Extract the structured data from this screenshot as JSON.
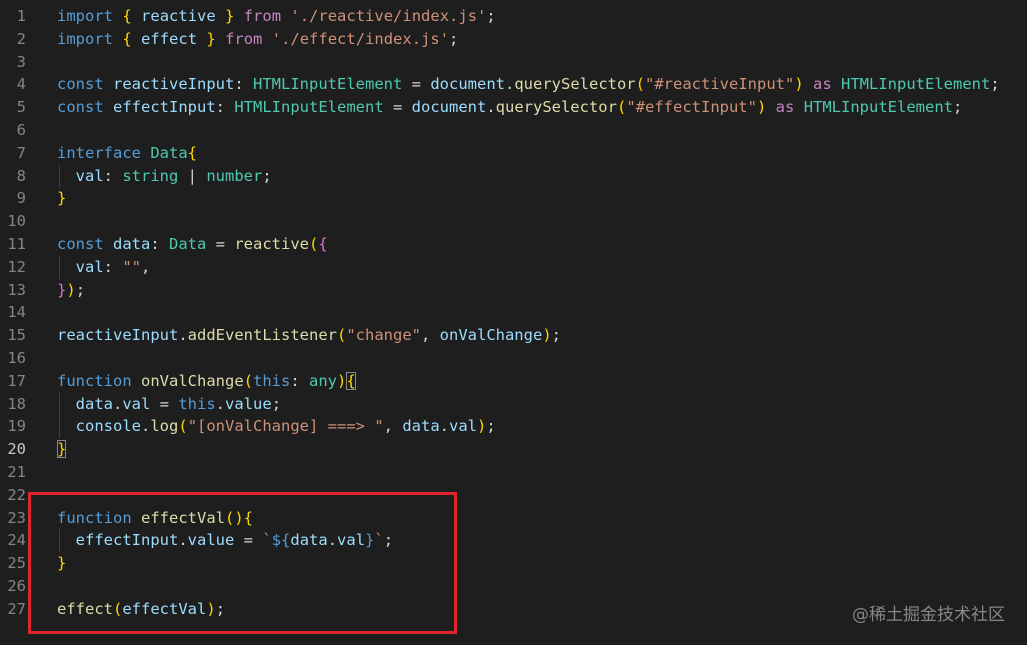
{
  "editor": {
    "active_line": 20,
    "lines": [
      {
        "n": "1",
        "indent": 0,
        "tokens": [
          [
            "kw",
            "import"
          ],
          [
            "pun",
            " "
          ],
          [
            "br1",
            "{"
          ],
          [
            "pun",
            " "
          ],
          [
            "var",
            "reactive"
          ],
          [
            "pun",
            " "
          ],
          [
            "br1",
            "}"
          ],
          [
            "pun",
            " "
          ],
          [
            "ctl",
            "from"
          ],
          [
            "pun",
            " "
          ],
          [
            "str",
            "'./reactive/index.js'"
          ],
          [
            "pun",
            ";"
          ]
        ]
      },
      {
        "n": "2",
        "indent": 0,
        "tokens": [
          [
            "kw",
            "import"
          ],
          [
            "pun",
            " "
          ],
          [
            "br1",
            "{"
          ],
          [
            "pun",
            " "
          ],
          [
            "var",
            "effect"
          ],
          [
            "pun",
            " "
          ],
          [
            "br1",
            "}"
          ],
          [
            "pun",
            " "
          ],
          [
            "ctl",
            "from"
          ],
          [
            "pun",
            " "
          ],
          [
            "str",
            "'./effect/index.js'"
          ],
          [
            "pun",
            ";"
          ]
        ]
      },
      {
        "n": "3",
        "indent": 0,
        "tokens": []
      },
      {
        "n": "4",
        "indent": 0,
        "tokens": [
          [
            "kw",
            "const"
          ],
          [
            "pun",
            " "
          ],
          [
            "var",
            "reactiveInput"
          ],
          [
            "pun",
            ": "
          ],
          [
            "typ",
            "HTMLInputElement"
          ],
          [
            "pun",
            " = "
          ],
          [
            "var",
            "document"
          ],
          [
            "pun",
            "."
          ],
          [
            "fn",
            "querySelector"
          ],
          [
            "br1",
            "("
          ],
          [
            "str",
            "\"#reactiveInput\""
          ],
          [
            "br1",
            ")"
          ],
          [
            "pun",
            " "
          ],
          [
            "ctl",
            "as"
          ],
          [
            "pun",
            " "
          ],
          [
            "typ",
            "HTMLInputElement"
          ],
          [
            "pun",
            ";"
          ]
        ]
      },
      {
        "n": "5",
        "indent": 0,
        "tokens": [
          [
            "kw",
            "const"
          ],
          [
            "pun",
            " "
          ],
          [
            "var",
            "effectInput"
          ],
          [
            "pun",
            ": "
          ],
          [
            "typ",
            "HTMLInputElement"
          ],
          [
            "pun",
            " = "
          ],
          [
            "var",
            "document"
          ],
          [
            "pun",
            "."
          ],
          [
            "fn",
            "querySelector"
          ],
          [
            "br1",
            "("
          ],
          [
            "str",
            "\"#effectInput\""
          ],
          [
            "br1",
            ")"
          ],
          [
            "pun",
            " "
          ],
          [
            "ctl",
            "as"
          ],
          [
            "pun",
            " "
          ],
          [
            "typ",
            "HTMLInputElement"
          ],
          [
            "pun",
            ";"
          ]
        ]
      },
      {
        "n": "6",
        "indent": 0,
        "tokens": []
      },
      {
        "n": "7",
        "indent": 0,
        "tokens": [
          [
            "kw",
            "interface"
          ],
          [
            "pun",
            " "
          ],
          [
            "typ",
            "Data"
          ],
          [
            "br1",
            "{"
          ]
        ]
      },
      {
        "n": "8",
        "indent": 1,
        "tokens": [
          [
            "var",
            "val"
          ],
          [
            "pun",
            ": "
          ],
          [
            "typ",
            "string"
          ],
          [
            "pun",
            " | "
          ],
          [
            "typ",
            "number"
          ],
          [
            "pun",
            ";"
          ]
        ]
      },
      {
        "n": "9",
        "indent": 0,
        "tokens": [
          [
            "br1",
            "}"
          ]
        ]
      },
      {
        "n": "10",
        "indent": 0,
        "tokens": []
      },
      {
        "n": "11",
        "indent": 0,
        "tokens": [
          [
            "kw",
            "const"
          ],
          [
            "pun",
            " "
          ],
          [
            "var",
            "data"
          ],
          [
            "pun",
            ": "
          ],
          [
            "typ",
            "Data"
          ],
          [
            "pun",
            " = "
          ],
          [
            "fn",
            "reactive"
          ],
          [
            "br1",
            "("
          ],
          [
            "br2",
            "{"
          ]
        ]
      },
      {
        "n": "12",
        "indent": 1,
        "tokens": [
          [
            "var",
            "val"
          ],
          [
            "pun",
            ": "
          ],
          [
            "str",
            "\"\""
          ],
          [
            "pun",
            ","
          ]
        ]
      },
      {
        "n": "13",
        "indent": 0,
        "tokens": [
          [
            "br2",
            "}"
          ],
          [
            "br1",
            ")"
          ],
          [
            "pun",
            ";"
          ]
        ]
      },
      {
        "n": "14",
        "indent": 0,
        "tokens": []
      },
      {
        "n": "15",
        "indent": 0,
        "tokens": [
          [
            "var",
            "reactiveInput"
          ],
          [
            "pun",
            "."
          ],
          [
            "fn",
            "addEventListener"
          ],
          [
            "br1",
            "("
          ],
          [
            "str",
            "\"change\""
          ],
          [
            "pun",
            ", "
          ],
          [
            "var",
            "onValChange"
          ],
          [
            "br1",
            ")"
          ],
          [
            "pun",
            ";"
          ]
        ]
      },
      {
        "n": "16",
        "indent": 0,
        "tokens": []
      },
      {
        "n": "17",
        "indent": 0,
        "tokens": [
          [
            "kw",
            "function"
          ],
          [
            "pun",
            " "
          ],
          [
            "fn",
            "onValChange"
          ],
          [
            "br1",
            "("
          ],
          [
            "kw",
            "this"
          ],
          [
            "pun",
            ": "
          ],
          [
            "typ",
            "any"
          ],
          [
            "br1",
            ")"
          ],
          [
            "br1 cursor-brace",
            "{"
          ]
        ]
      },
      {
        "n": "18",
        "indent": 1,
        "tokens": [
          [
            "var",
            "data"
          ],
          [
            "pun",
            "."
          ],
          [
            "var",
            "val"
          ],
          [
            "pun",
            " = "
          ],
          [
            "kw",
            "this"
          ],
          [
            "pun",
            "."
          ],
          [
            "var",
            "value"
          ],
          [
            "pun",
            ";"
          ]
        ]
      },
      {
        "n": "19",
        "indent": 1,
        "tokens": [
          [
            "var",
            "console"
          ],
          [
            "pun",
            "."
          ],
          [
            "fn",
            "log"
          ],
          [
            "br1",
            "("
          ],
          [
            "str",
            "\"[onValChange] ===> \""
          ],
          [
            "pun",
            ", "
          ],
          [
            "var",
            "data"
          ],
          [
            "pun",
            "."
          ],
          [
            "var",
            "val"
          ],
          [
            "br1",
            ")"
          ],
          [
            "pun",
            ";"
          ]
        ]
      },
      {
        "n": "20",
        "indent": 0,
        "tokens": [
          [
            "br1 cursor-brace",
            "}"
          ]
        ]
      },
      {
        "n": "21",
        "indent": 0,
        "tokens": []
      },
      {
        "n": "22",
        "indent": 0,
        "tokens": []
      },
      {
        "n": "23",
        "indent": 0,
        "tokens": [
          [
            "kw",
            "function"
          ],
          [
            "pun",
            " "
          ],
          [
            "fn",
            "effectVal"
          ],
          [
            "br1",
            "()"
          ],
          [
            "br1",
            "{"
          ]
        ]
      },
      {
        "n": "24",
        "indent": 1,
        "tokens": [
          [
            "var",
            "effectInput"
          ],
          [
            "pun",
            "."
          ],
          [
            "var",
            "value"
          ],
          [
            "pun",
            " = "
          ],
          [
            "str",
            "`"
          ],
          [
            "kw",
            "${"
          ],
          [
            "var",
            "data"
          ],
          [
            "pun",
            "."
          ],
          [
            "var",
            "val"
          ],
          [
            "kw",
            "}"
          ],
          [
            "str",
            "`"
          ],
          [
            "pun",
            ";"
          ]
        ]
      },
      {
        "n": "25",
        "indent": 0,
        "tokens": [
          [
            "br1",
            "}"
          ]
        ]
      },
      {
        "n": "26",
        "indent": 0,
        "tokens": []
      },
      {
        "n": "27",
        "indent": 0,
        "tokens": [
          [
            "fn",
            "effect"
          ],
          [
            "br1",
            "("
          ],
          [
            "var",
            "effectVal"
          ],
          [
            "br1",
            ")"
          ],
          [
            "pun",
            ";"
          ]
        ]
      }
    ]
  },
  "highlight": {
    "color": "#e1232b"
  },
  "watermark": {
    "text": "@稀土掘金技术社区"
  }
}
